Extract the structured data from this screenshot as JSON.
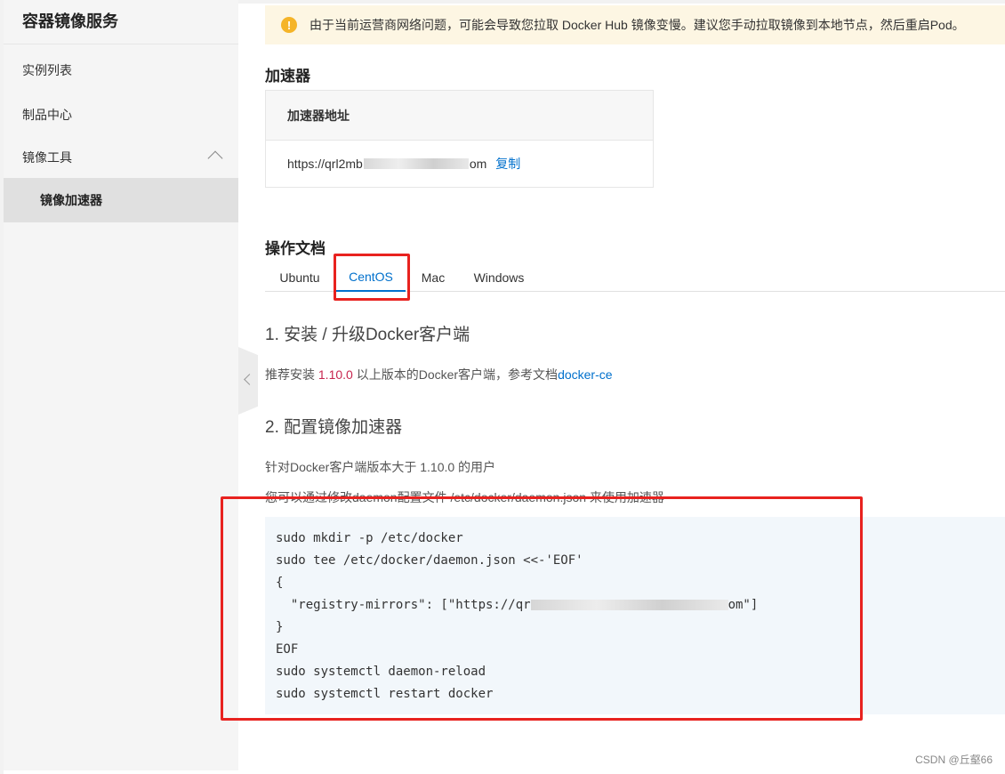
{
  "sidebar": {
    "title": "容器镜像服务",
    "items": [
      {
        "label": "实例列表"
      },
      {
        "label": "制品中心"
      },
      {
        "label": "镜像工具"
      },
      {
        "label": "镜像加速器"
      }
    ]
  },
  "alert": {
    "icon": "warning-icon",
    "icon_glyph": "!",
    "text": "由于当前运营商网络问题，可能会导致您拉取 Docker Hub 镜像变慢。建议您手动拉取镜像到本地节点，然后重启Pod。"
  },
  "accelerator": {
    "title": "加速器",
    "column_header": "加速器地址",
    "address_prefix": "https://qrl2mb",
    "address_suffix": "om",
    "copy_label": "复制"
  },
  "docs": {
    "title": "操作文档",
    "tabs": [
      {
        "label": "Ubuntu"
      },
      {
        "label": "CentOS"
      },
      {
        "label": "Mac"
      },
      {
        "label": "Windows"
      }
    ],
    "active_tab": "CentOS",
    "step1_title": "1. 安装 / 升级Docker客户端",
    "step1_prefix": "推荐安装 ",
    "step1_version": "1.10.0",
    "step1_mid": " 以上版本的Docker客户端，参考文档",
    "step1_link": "docker-ce",
    "step2_title": "2. 配置镜像加速器",
    "step2_line1": "针对Docker客户端版本大于 1.10.0 的用户",
    "step2_line2": "您可以通过修改daemon配置文件 /etc/docker/daemon.json 来使用加速器"
  },
  "code": {
    "lines": [
      "sudo mkdir -p /etc/docker",
      "sudo tee /etc/docker/daemon.json <<-'EOF'",
      "{",
      "  \"registry-mirrors\": [\"https://qr",
      "}",
      "EOF",
      "sudo systemctl daemon-reload",
      "sudo systemctl restart docker"
    ],
    "mirror_suffix": "om\"]"
  },
  "watermark": "CSDN @丘壑66",
  "colors": {
    "accent": "#0070cc",
    "highlight_box": "#e8221f",
    "alert_bg": "#fdf6e3",
    "warn": "#f5b428",
    "version": "#c7254e"
  }
}
